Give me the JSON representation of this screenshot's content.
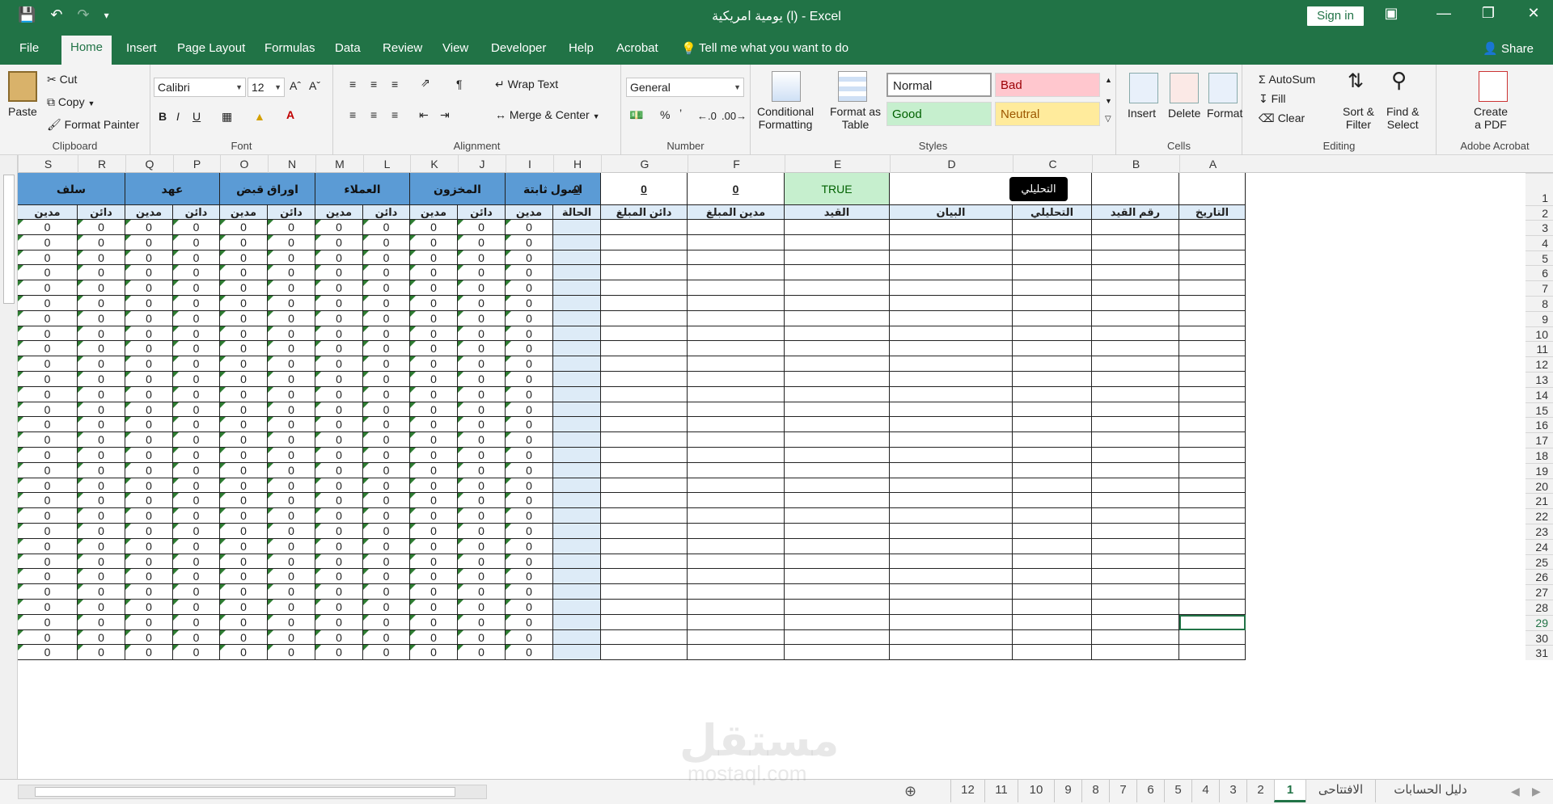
{
  "titlebar": {
    "title": "يومية امريكية (l)  -  Excel",
    "signin": "Sign in"
  },
  "tabs": {
    "file": "File",
    "home": "Home",
    "insert": "Insert",
    "page_layout": "Page Layout",
    "formulas": "Formulas",
    "data": "Data",
    "review": "Review",
    "view": "View",
    "developer": "Developer",
    "help": "Help",
    "acrobat": "Acrobat",
    "tell_me": "Tell me what you want to do",
    "share": "Share"
  },
  "ribbon": {
    "clipboard": {
      "label": "Clipboard",
      "paste": "Paste",
      "cut": "Cut",
      "copy": "Copy",
      "format_painter": "Format Painter"
    },
    "font": {
      "label": "Font",
      "name": "Calibri",
      "size": "12"
    },
    "alignment": {
      "label": "Alignment",
      "wrap_text": "Wrap Text",
      "merge_center": "Merge & Center"
    },
    "number": {
      "label": "Number",
      "format": "General"
    },
    "styles": {
      "label": "Styles",
      "conditional": "Conditional",
      "conditional2": "Formatting",
      "format_as": "Format as",
      "format_as2": "Table",
      "normal": "Normal",
      "bad": "Bad",
      "good": "Good",
      "neutral": "Neutral"
    },
    "cells": {
      "label": "Cells",
      "insert": "Insert",
      "delete": "Delete",
      "format": "Format"
    },
    "editing": {
      "label": "Editing",
      "autosum": "AutoSum",
      "fill": "Fill",
      "clear": "Clear",
      "sort": "Sort &",
      "sort2": "Filter",
      "find": "Find &",
      "find2": "Select"
    },
    "acrobat": {
      "label": "Adobe Acrobat",
      "create": "Create",
      "create2": "a PDF"
    }
  },
  "columns": [
    "S",
    "R",
    "Q",
    "P",
    "O",
    "N",
    "M",
    "L",
    "K",
    "J",
    "I",
    "H",
    "G",
    "F",
    "E",
    "D",
    "C",
    "B",
    "A"
  ],
  "row1": {
    "groups": [
      "سلف",
      "عهد",
      "اوراق قبض",
      "العملاء",
      "المخزون",
      "اصول ثابتة"
    ],
    "h": "0",
    "g": "0",
    "f": "0",
    "e": "TRUE",
    "button": "التحليلي"
  },
  "row2": {
    "debit": "مدين",
    "credit": "دائن",
    "h": "الحالة",
    "g": "دائن المبلغ",
    "f": "مدين المبلغ",
    "e": "القيد",
    "d": "البيان",
    "c": "التحليلي",
    "b": "رقم القيد",
    "a": "التاريخ"
  },
  "cell_value": "0",
  "rows": [
    "1",
    "2",
    "3",
    "4",
    "5",
    "6",
    "7",
    "8",
    "9",
    "10",
    "11",
    "12",
    "13",
    "14",
    "15",
    "16",
    "17",
    "18",
    "19",
    "20",
    "21",
    "22",
    "23",
    "24",
    "25",
    "26",
    "27",
    "28",
    "29",
    "30",
    "31"
  ],
  "sheets": [
    "12",
    "11",
    "10",
    "9",
    "8",
    "7",
    "6",
    "5",
    "4",
    "3",
    "2",
    "1",
    "الافتتاحى",
    "دليل الحسابات"
  ],
  "active_sheet": "1",
  "watermark": "مستقل",
  "watermark2": "mostaql.com",
  "colors": {
    "accent": "#217346",
    "header_blue": "#5b9bd5",
    "light_blue": "#ddebf7",
    "good": "#c6efce",
    "bad": "#ffc7ce",
    "neutral": "#ffeb9c"
  }
}
